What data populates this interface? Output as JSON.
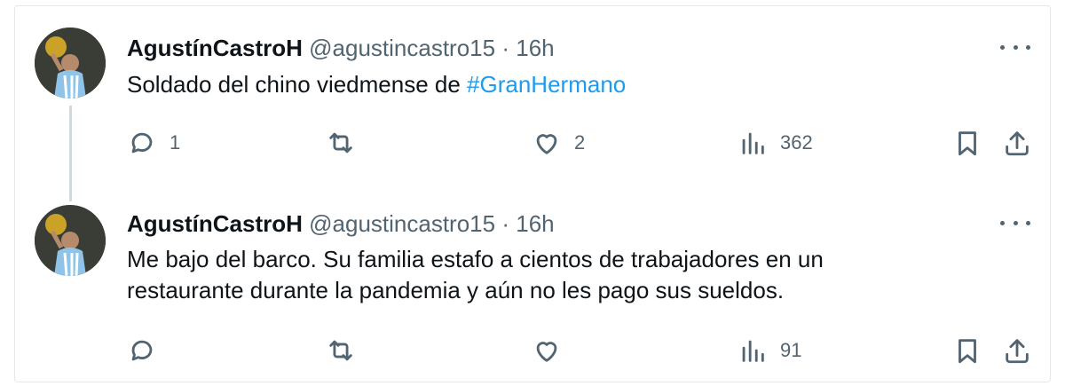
{
  "tweets": [
    {
      "author": {
        "name": "AgustínCastroH",
        "handle": "@agustincastro15"
      },
      "separator": "·",
      "time": "16h",
      "text_plain": "Soldado del chino viedmense de ",
      "hashtag": "#GranHermano",
      "counts": {
        "replies": "1",
        "retweets": "",
        "likes": "2",
        "views": "362"
      }
    },
    {
      "author": {
        "name": "AgustínCastroH",
        "handle": "@agustincastro15"
      },
      "separator": "·",
      "time": "16h",
      "text_line1": "Me bajo del barco. Su familia estafo a cientos de trabajadores en un",
      "text_line2": "restaurante durante la pandemia y aún no les pago sus sueldos.",
      "counts": {
        "replies": "",
        "retweets": "",
        "likes": "",
        "views": "91"
      }
    }
  ],
  "icons": {
    "reply": "reply-icon",
    "retweet": "retweet-icon",
    "like": "heart-icon",
    "views": "views-chart-icon",
    "bookmark": "bookmark-icon",
    "share": "share-icon",
    "more": "more-dots-icon"
  },
  "colors": {
    "link": "#1d9bf0",
    "text": "#0f1419",
    "secondary": "#536471",
    "thread_line": "#cfd9de"
  }
}
